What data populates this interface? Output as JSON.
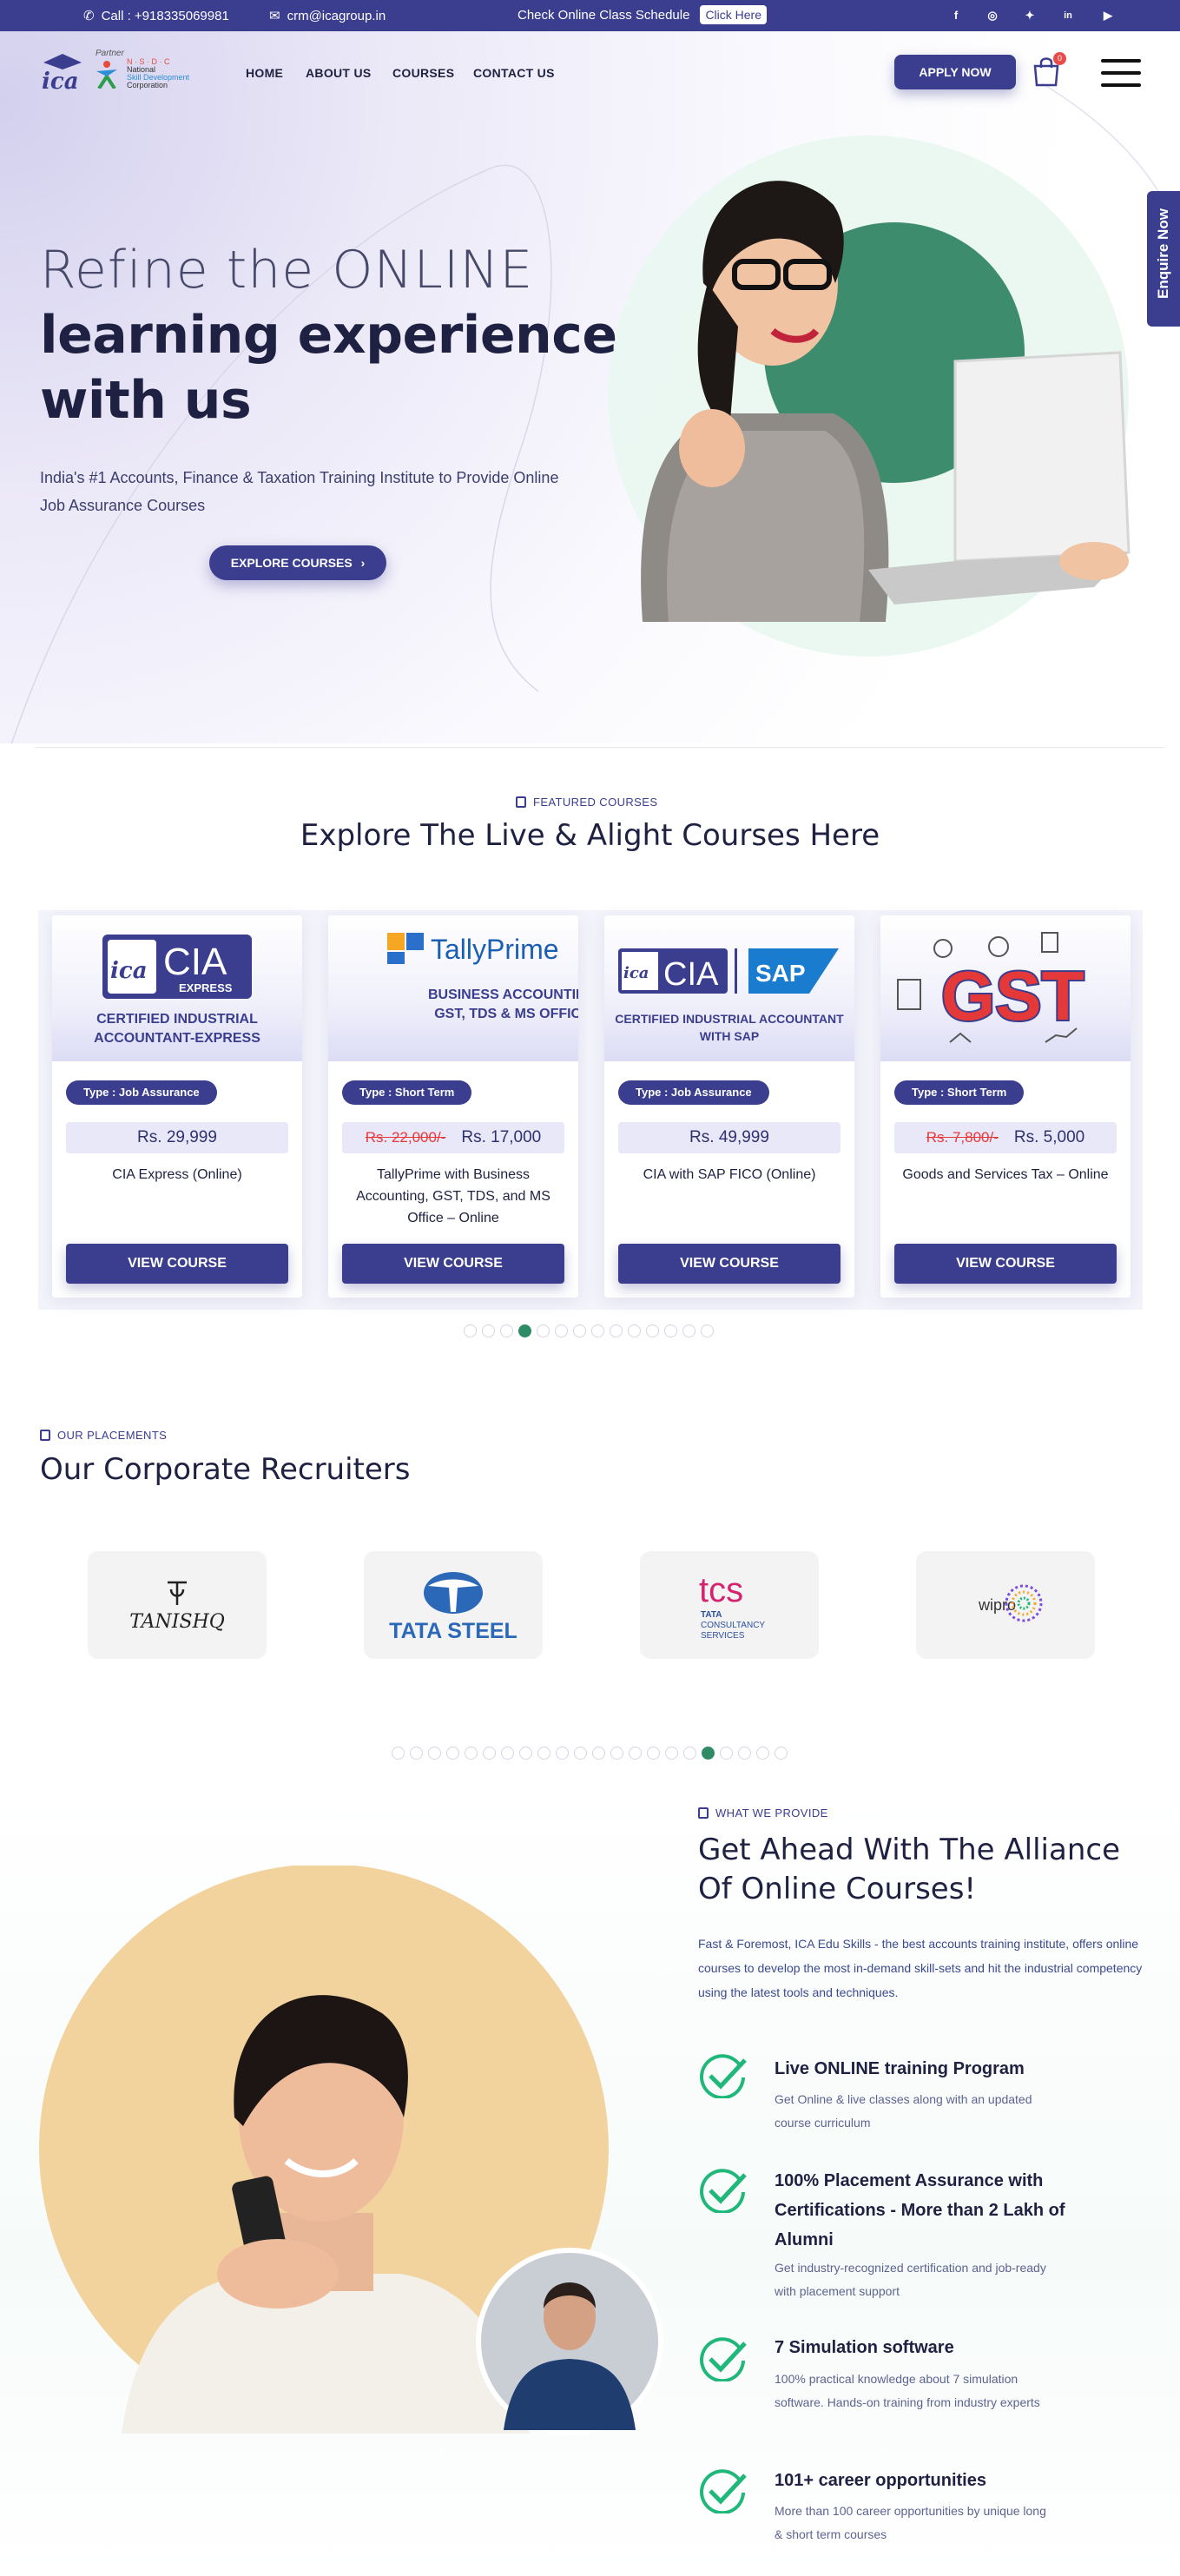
{
  "topbar": {
    "phone": "Call : +918335069981",
    "email": "crm@icagroup.in",
    "schedule_text": "Check Online Class Schedule",
    "click_here": "Click Here",
    "social": [
      "facebook-icon",
      "whatsapp-icon",
      "twitter-icon",
      "linkedin-icon",
      "youtube-icon"
    ]
  },
  "header": {
    "logo_text": "ica",
    "partner_label": "Partner",
    "nsdc_line1": "N · S · D · C",
    "nsdc_line2": "National",
    "nsdc_line3": "Skill Development",
    "nsdc_line4": "Corporation",
    "nav": [
      "HOME",
      "ABOUT US",
      "COURSES",
      "CONTACT US"
    ],
    "apply": "APPLY NOW",
    "cart_count": "0"
  },
  "hero": {
    "line1": "Refine the ONLINE",
    "line2": "learning experience",
    "line3": "with us",
    "subtitle": "India's #1 Accounts, Finance & Taxation Training Institute to Provide Online Job Assurance Courses",
    "cta": "EXPLORE COURSES",
    "enquire": "Enquire Now"
  },
  "featured": {
    "tag": "FEATURED COURSES",
    "title": "Explore The Live & Alight Courses Here",
    "courses": [
      {
        "banner_main": "CIA",
        "banner_badge": "EXPRESS",
        "banner_line1": "CERTIFIED INDUSTRIAL",
        "banner_line2": "ACCOUNTANT-EXPRESS",
        "type": "Type : Job Assurance",
        "old_price": "",
        "price": "Rs. 29,999",
        "name": "CIA Express (Online)",
        "button": "VIEW COURSE"
      },
      {
        "banner_main": "TallyPrime",
        "banner_badge": "",
        "banner_line1": "BUSINESS ACCOUNTING",
        "banner_line2": "GST, TDS & MS OFFICE",
        "type": "Type : Short Term",
        "old_price": "Rs. 22,000/-",
        "price": "Rs. 17,000",
        "name": "TallyPrime with Business Accounting, GST, TDS, and MS Office – Online",
        "button": "VIEW COURSE"
      },
      {
        "banner_main": "CIA",
        "banner_badge": "SAP",
        "banner_line1": "CERTIFIED INDUSTRIAL ACCOUNTANT",
        "banner_line2": "WITH SAP",
        "type": "Type : Job Assurance",
        "old_price": "",
        "price": "Rs. 49,999",
        "name": "CIA with SAP FICO (Online)",
        "button": "VIEW COURSE"
      },
      {
        "banner_main": "GST",
        "banner_badge": "",
        "banner_line1": "",
        "banner_line2": "",
        "type": "Type : Short Term",
        "old_price": "Rs. 7,800/-",
        "price": "Rs. 5,000",
        "name": "Goods and Services Tax – Online",
        "button": "VIEW COURSE"
      }
    ],
    "pager_count": 14,
    "pager_active": 3
  },
  "placements": {
    "tag": "OUR PLACEMENTS",
    "title": "Our Corporate Recruiters",
    "logos": [
      {
        "name": "TANISHQ"
      },
      {
        "name": "TATA STEEL"
      },
      {
        "name": "tcs",
        "sub1": "TATA",
        "sub2": "CONSULTANCY",
        "sub3": "SERVICES"
      },
      {
        "name": "wipro"
      }
    ],
    "pager_count": 22,
    "pager_active": 17
  },
  "provide": {
    "tag": "WHAT WE PROVIDE",
    "title_line1": "Get Ahead With The Alliance",
    "title_line2": "Of Online Courses!",
    "description": "Fast & Foremost, ICA Edu Skills - the best accounts training institute, offers online courses to develop the most in-demand skill-sets and hit the industrial competency using the latest tools and techniques.",
    "features": [
      {
        "title": "Live ONLINE training Program",
        "desc": "Get Online & live classes along with an updated course curriculum"
      },
      {
        "title": "100% Placement Assurance with Certifications - More than 2 Lakh of Alumni",
        "desc": "Get industry-recognized certification and job-ready with placement support"
      },
      {
        "title": "7 Simulation software",
        "desc": "100% practical knowledge about 7 simulation software. Hands-on training from industry experts"
      },
      {
        "title": "101+ career opportunities",
        "desc": "More than 100 career opportunities by unique long & short term courses"
      }
    ]
  },
  "colors": {
    "primary": "#3b3d8f",
    "accent_green": "#2e8b66",
    "check_green": "#1fb87a",
    "strike_red": "#e53939"
  }
}
